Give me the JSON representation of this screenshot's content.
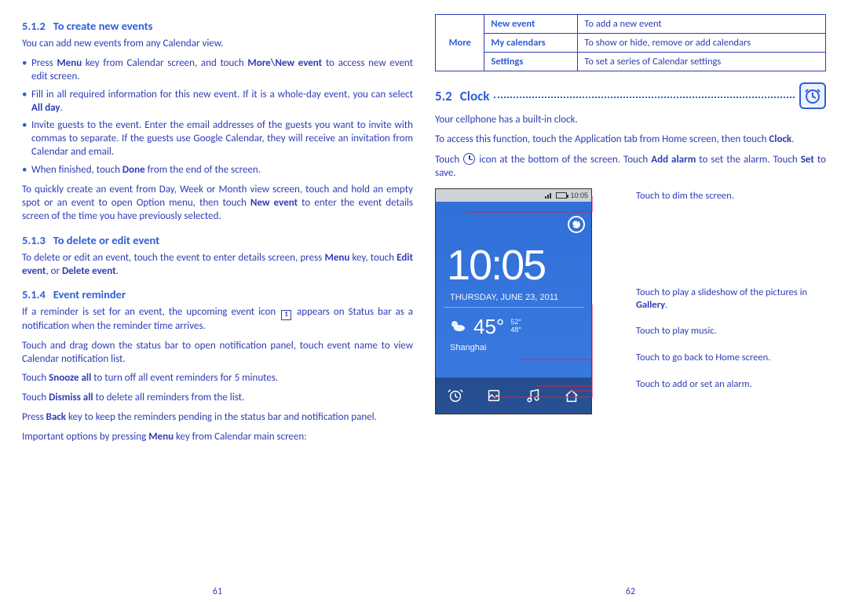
{
  "left": {
    "h_5_1_2_num": "5.1.2",
    "h_5_1_2": "To create new events",
    "p1": "You can add new events from any Calendar view.",
    "b1a": "Press ",
    "b1b": "Menu",
    "b1c": " key from Calendar screen, and touch ",
    "b1d": "More\\New event",
    "b1e": " to access new event edit screen.",
    "b2a": "Fill in all required information for this new event. If it is a whole-day event, you can select ",
    "b2b": "All day",
    "b2c": ".",
    "b3": "Invite guests to the event. Enter the email addresses of the guests you want to invite with commas to separate. If the guests use Google Calendar, they will receive an invitation from Calendar and email.",
    "b4a": "When finished, touch ",
    "b4b": "Done",
    "b4c": " from the end of the screen.",
    "p2a": "To quickly create an event from Day, Week or Month view screen, touch and hold an empty spot or an event to open Option menu, then touch ",
    "p2b": "New event",
    "p2c": " to enter the event details screen of the time you have previously selected.",
    "h_5_1_3_num": "5.1.3",
    "h_5_1_3": "To delete or edit event",
    "p3a": "To delete or edit an event, touch the event to enter details screen, press ",
    "p3b": "Menu",
    "p3c": " key, touch ",
    "p3d": "Edit event",
    "p3e": ", or ",
    "p3f": "Delete event",
    "p3g": ".",
    "h_5_1_4_num": "5.1.4",
    "h_5_1_4": "Event reminder",
    "p4a": "If a reminder is set for an event, the upcoming event icon ",
    "p4_badge": "1",
    "p4b": " appears on Status bar as a notification when the reminder time arrives.",
    "p5": "Touch and drag down the status bar to open notification panel, touch event name to view Calendar notification list.",
    "p6a": "Touch ",
    "p6b": "Snooze all",
    "p6c": " to turn off all event reminders for 5 minutes.",
    "p7a": "Touch ",
    "p7b": "Dismiss all",
    "p7c": " to delete all reminders from the list.",
    "p8a": "Press ",
    "p8b": "Back",
    "p8c": " key to keep the reminders pending in the status bar and notification panel.",
    "p9a": "Important options by pressing ",
    "p9b": "Menu",
    "p9c": " key from Calendar main screen:",
    "pagenum": "61"
  },
  "right": {
    "table": {
      "side": "More",
      "rows": [
        {
          "label": "New event",
          "desc": "To add a new event"
        },
        {
          "label": "My calendars",
          "desc": "To show or hide, remove or add calendars"
        },
        {
          "label": "Settings",
          "desc": "To set a series of Calendar settings"
        }
      ]
    },
    "h_5_2_num": "5.2",
    "h_5_2": "Clock",
    "p1": "Your cellphone has a built-in clock.",
    "p2a": "To access this function, touch the Application tab from Home screen, then touch ",
    "p2b": "Clock",
    "p2c": ".",
    "p3a": "Touch ",
    "p3b": " icon at the bottom of the screen. Touch ",
    "p3c": "Add alarm",
    "p3d": " to set the alarm. Touch ",
    "p3e": "Set",
    "p3f": " to save.",
    "phone": {
      "status_time": "10:05",
      "big_time": "10:05",
      "date": "THURSDAY, JUNE 23, 2011",
      "temp": "45°",
      "hi": "52°",
      "lo": "48°",
      "city": "Shanghai"
    },
    "callouts": {
      "c1": "Touch to dim the screen.",
      "c2a": "Touch to play a slideshow of the pictures in ",
      "c2b": "Gallery",
      "c2c": ".",
      "c3": "Touch to play music.",
      "c4": "Touch to go back to Home screen.",
      "c5": "Touch to add or set an alarm."
    },
    "pagenum": "62"
  }
}
